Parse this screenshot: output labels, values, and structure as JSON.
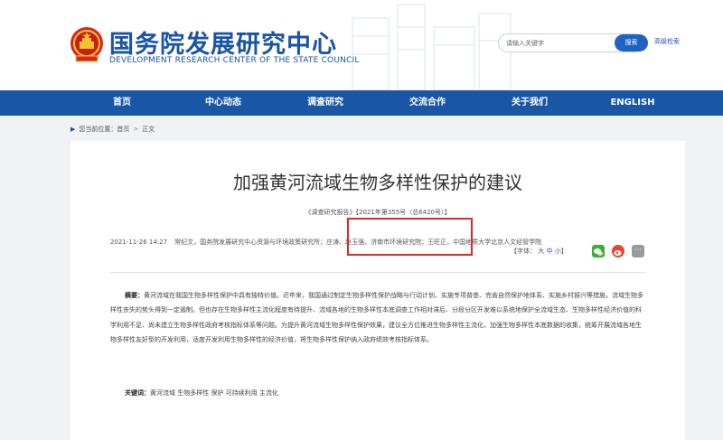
{
  "header": {
    "title": "国务院发展研究中心",
    "subtitle": "DEVELOPMENT RESEARCH CENTER OF THE STATE COUNCIL",
    "search_placeholder": "请输入关键字",
    "search_button": "搜索",
    "advanced_search": "高级检索"
  },
  "nav": {
    "items": [
      "首页",
      "中心动态",
      "调查研究",
      "交流合作",
      "关于我们",
      "ENGLISH"
    ]
  },
  "breadcrumb": {
    "label": "您当前位置：",
    "home": "首页",
    "current": "正文"
  },
  "article": {
    "title": "加强黄河流域生物多样性保护的建议",
    "source": "《调查研究报告》【2021年第355号（总6420号）】",
    "date": "2021-11-26 14:27",
    "authors": "常纪文，国务院发展研究中心资源与环境政策研究所；庄涛、赵玉强，济南市环境研究院；王旺正，中国地质大学北京人文经管学院",
    "font_size_label": "【字体：",
    "font_sizes": [
      "大",
      "中",
      "小"
    ],
    "font_size_end": "】",
    "abstract_label": "摘要：",
    "abstract_text": "黄河流域在我国生物多样性保护中具有独特价值。近年来，我国通过制定生物多样性保护战略与行动计划、实施专项普查、完善自然保护地体系、实施乡村振兴等措施，流域生物多样性丧失的势头得到一定遏制。但也存在生物多样性主流化程度有待提升、流域各地的生物多样性本底调查工作相对滞后、分段分区开发难以系统地保护全流域生态、生物多样性经济价值的科学利用不足、尚未建立生物多样性政府考核指标体系等问题。为提升黄河流域生物多样性保护效果，建议全方位推进生物多样性主流化，加强生物多样性本底数据的收集，统筹开展流域各地生物多样性友好型的开发利用，适度开发利用生物多样性的经济价值，将生物多样性保护纳入政府绩效考核指标体系。",
    "keywords_label": "关键词：",
    "keywords": "黄河流域 生物多样性 保护 可持续利用 主流化"
  },
  "icons": {
    "wechat": "wechat-share-icon",
    "weibo": "weibo-share-icon",
    "more": "more-share-icon"
  },
  "colors": {
    "brand_blue": "#1a56a6",
    "highlight_red": "#e02828"
  }
}
